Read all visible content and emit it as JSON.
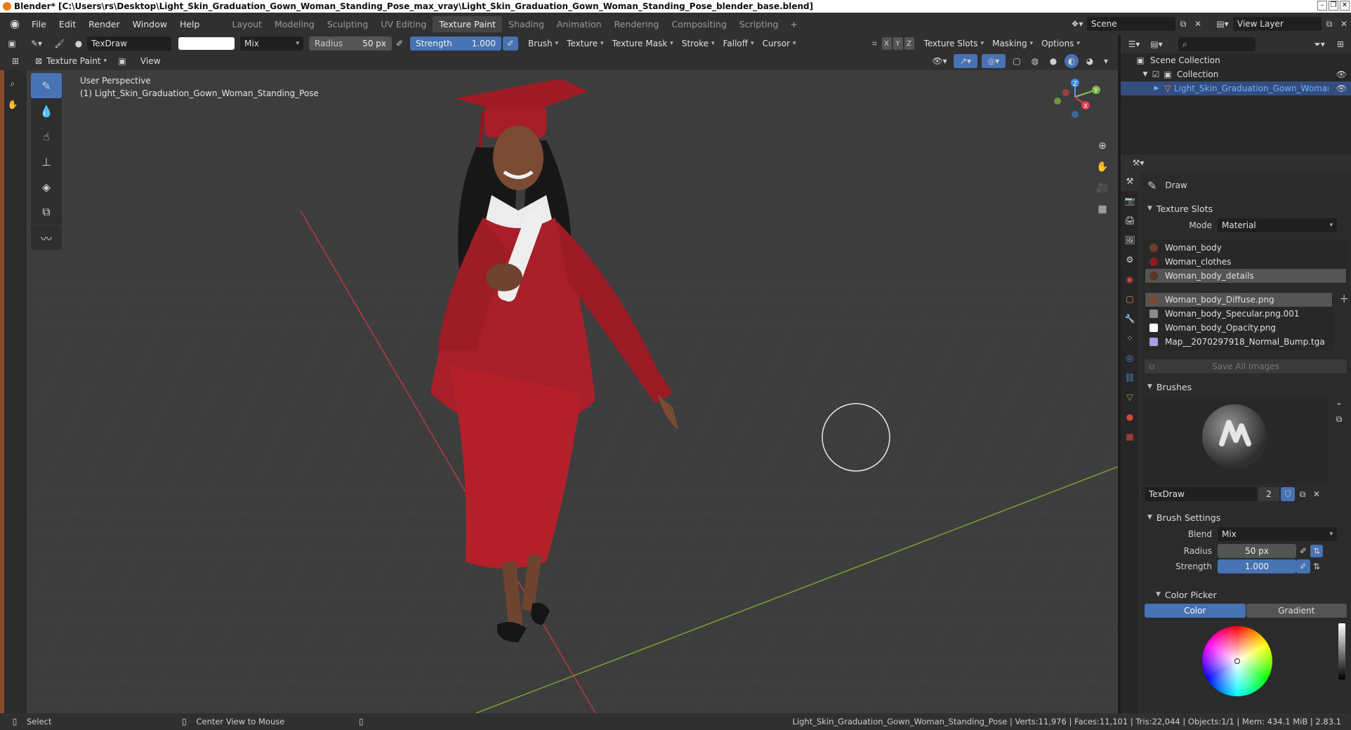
{
  "titlebar": {
    "title": "Blender* [C:\\Users\\rs\\Desktop\\Light_Skin_Graduation_Gown_Woman_Standing_Pose_max_vray\\Light_Skin_Graduation_Gown_Woman_Standing_Pose_blender_base.blend]"
  },
  "menu": [
    "File",
    "Edit",
    "Render",
    "Window",
    "Help"
  ],
  "workspaces": [
    "Layout",
    "Modeling",
    "Sculpting",
    "UV Editing",
    "Texture Paint",
    "Shading",
    "Animation",
    "Rendering",
    "Compositing",
    "Scripting"
  ],
  "active_workspace": "Texture Paint",
  "scene": {
    "name": "Scene",
    "view_layer": "View Layer"
  },
  "toolheader": {
    "brush_name": "TexDraw",
    "blend": "Mix",
    "radius_label": "Radius",
    "radius_value": "50 px",
    "strength_label": "Strength",
    "strength_value": "1.000",
    "menus": [
      "Brush",
      "Texture",
      "Texture Mask",
      "Stroke",
      "Falloff",
      "Cursor"
    ],
    "axes": [
      "X",
      "Y",
      "Z"
    ],
    "right_menus": [
      "Texture Slots",
      "Masking",
      "Options"
    ]
  },
  "header2": {
    "mode": "Texture Paint",
    "view": "View"
  },
  "viewport": {
    "perspective": "User Perspective",
    "object_label": "(1) Light_Skin_Graduation_Gown_Woman_Standing_Pose",
    "gizmo": {
      "x": "X",
      "y": "Y",
      "z": "Z"
    }
  },
  "outliner": {
    "root": "Scene Collection",
    "collection": "Collection",
    "object": "Light_Skin_Graduation_Gown_Woman_Stand"
  },
  "properties": {
    "tool": "Draw",
    "texture_slots": {
      "title": "Texture Slots",
      "mode_label": "Mode",
      "mode_value": "Material",
      "materials": [
        "Woman_body",
        "Woman_clothes",
        "Woman_body_details"
      ],
      "images": [
        "Woman_body_Diffuse.png",
        "Woman_body_Specular.png.001",
        "Woman_body_Opacity.png",
        "Map__2070297918_Normal_Bump.tga"
      ],
      "save_all": "Save All Images"
    },
    "brushes": {
      "title": "Brushes",
      "name": "TexDraw",
      "users": "2"
    },
    "brush_settings": {
      "title": "Brush Settings",
      "blend_label": "Blend",
      "blend_value": "Mix",
      "radius_label": "Radius",
      "radius_value": "50 px",
      "strength_label": "Strength",
      "strength_value": "1.000"
    },
    "color_picker": {
      "title": "Color Picker",
      "tab_color": "Color",
      "tab_gradient": "Gradient"
    }
  },
  "statusbar": {
    "select": "Select",
    "center": "Center View to Mouse",
    "stats": "Light_Skin_Graduation_Gown_Woman_Standing_Pose | Verts:11,976 | Faces:11,101 | Tris:22,044 | Objects:1/1 | Mem: 434.1 MiB | 2.83.1"
  },
  "colors": {
    "accent": "#4772b3",
    "gown": "#b3202a",
    "viewport_bg": "#3d3d3d"
  }
}
